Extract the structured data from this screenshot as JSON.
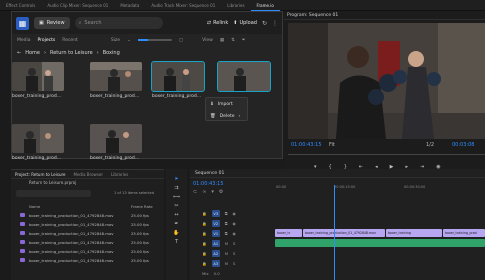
{
  "workspace_tabs": [
    "Effect Controls",
    "Audio Clip Mixer: Sequence 01",
    "Metadata",
    "Audio Track Mixer: Sequence 01",
    "Libraries",
    "Frame.io",
    "Program: Sequence 01"
  ],
  "toolbar": {
    "review_label": "Review",
    "search_placeholder": "Search",
    "relink_label": "Relink",
    "upload_label": "Upload"
  },
  "subtabs": {
    "media": "Media",
    "projects": "Projects",
    "recent": "Recent",
    "size": "Size",
    "view": "View"
  },
  "breadcrumb": {
    "home": "Home",
    "project": "Return to Leisure",
    "folder": "Boxing"
  },
  "tiles": [
    {
      "label": "boxer_training_prod...",
      "selected": false
    },
    {
      "label": "boxer_training_prod...",
      "selected": false
    },
    {
      "label": "boxer_training_prod...",
      "selected": true
    },
    {
      "label": "boxer_training_prod...",
      "selected": true
    },
    {
      "label": "boxer_training_prod...",
      "selected": false
    },
    {
      "label": "boxer_training_prod...",
      "selected": false
    }
  ],
  "context_menu": {
    "import": "Import",
    "delete": "Delete"
  },
  "program": {
    "title": "Program: Sequence 01",
    "timecode": "01:00:43:15",
    "fit": "Fit",
    "ratio": "1/2",
    "end_timecode": "00:03:08"
  },
  "project_panel": {
    "tabs": [
      "Project: Return to Leisure",
      "Media Browser",
      "Libraries"
    ],
    "path": "Return to Leisure.prproj",
    "count": "1 of 13 items selected",
    "col_name": "Name",
    "col_rate": "Frame Rate",
    "rows": [
      {
        "name": "boxer_training_production_01_4792848.mov",
        "fps": "25.00 fps"
      },
      {
        "name": "boxer_training_production_01_4792848.mov",
        "fps": "25.00 fps"
      },
      {
        "name": "boxer_training_production_01_4792848.mov",
        "fps": "25.00 fps"
      },
      {
        "name": "boxer_training_production_01_4792848.mov",
        "fps": "25.00 fps"
      },
      {
        "name": "boxer_training_production_01_4792848.mov",
        "fps": "25.00 fps"
      },
      {
        "name": "boxer_training_production_01_4792848.mov",
        "fps": "25.00 fps"
      }
    ],
    "row_colors": [
      "#8a67d6",
      "#8a67d6",
      "#8a67d6",
      "#8a67d6",
      "#8a67d6",
      "#8a67d6"
    ]
  },
  "timeline": {
    "title": "Sequence 01",
    "timecode": "01:00:43:15",
    "ruler": [
      "00:00",
      "00:00:15:00",
      "00:00:30:00"
    ],
    "tracks": [
      "V3",
      "V2",
      "V1",
      "A1",
      "A2",
      "A3",
      "Mix"
    ],
    "clips": {
      "v1_a": "boxer_tr",
      "v1_b": "boxer_training_production_01_4792848.mov",
      "v1_c": "boxer_training",
      "v1_d": "boxer_training_prod"
    },
    "mix_value": "0.0"
  },
  "colors": {
    "accent": "#2f8cff",
    "clip_video": "#b7a6f0",
    "clip_audio": "#2fa36a",
    "selection": "#1aa3c7"
  }
}
